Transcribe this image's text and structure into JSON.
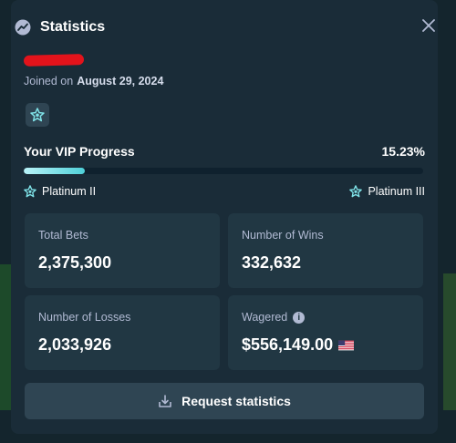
{
  "header": {
    "title": "Statistics",
    "title_icon": "chart-trend-icon",
    "close_icon": "close-icon"
  },
  "user": {
    "joined_prefix": "Joined on",
    "joined_date": "August 29, 2024"
  },
  "vip": {
    "badge_icon": "vip-star-icon",
    "progress_label": "Your VIP Progress",
    "progress_text": "15.23%",
    "progress_value": 15.23,
    "current_tier": "Platinum II",
    "next_tier": "Platinum III"
  },
  "stats": {
    "total_bets_label": "Total Bets",
    "total_bets": "2,375,300",
    "wins_label": "Number of Wins",
    "wins": "332,632",
    "losses_label": "Number of Losses",
    "losses": "2,033,926",
    "wagered_label": "Wagered",
    "wagered": "$556,149.00",
    "wagered_info_icon": "info-icon",
    "currency_flag_icon": "us-flag-icon"
  },
  "actions": {
    "request_label": "Request statistics",
    "request_icon": "download-icon"
  },
  "colors": {
    "modal_bg": "#1a2c38",
    "card_bg": "#213743",
    "button_bg": "#2f4553",
    "muted_text": "#b1bad3",
    "progress_fill": "#4fd0d8"
  }
}
